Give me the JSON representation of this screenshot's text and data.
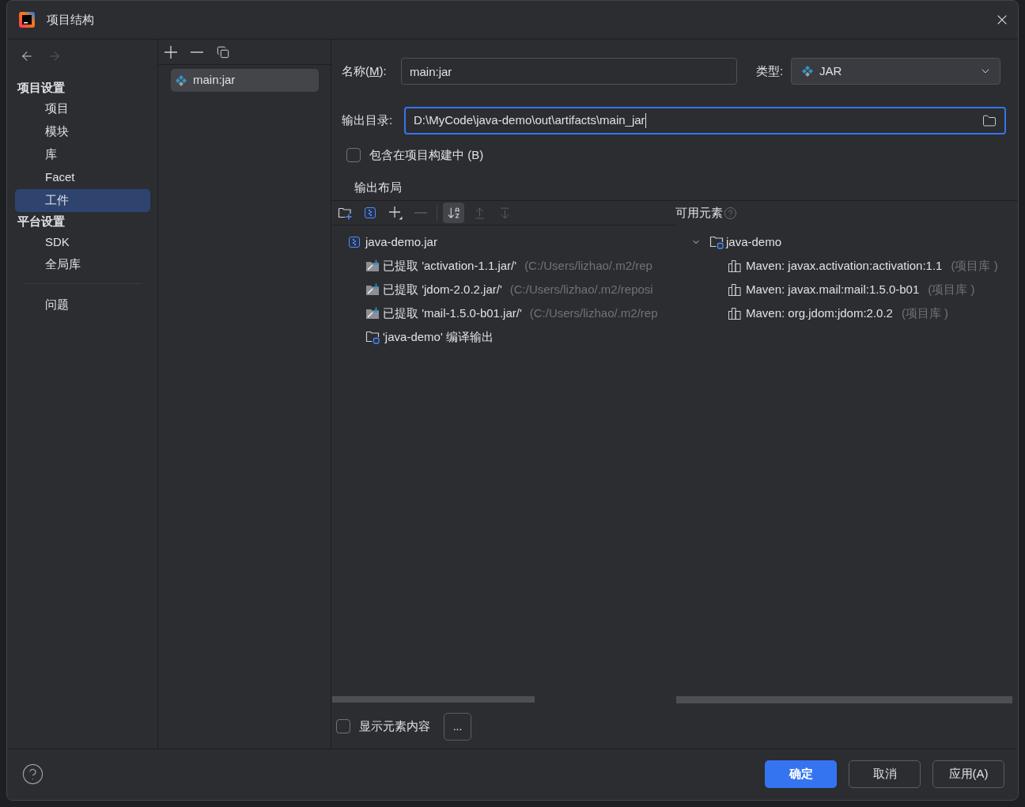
{
  "window": {
    "title": "项目结构"
  },
  "nav": [
    {
      "kind": "back",
      "disabled": false
    },
    {
      "kind": "forward",
      "disabled": true
    }
  ],
  "sidebar": {
    "sections": [
      {
        "heading": "项目设置",
        "items": [
          {
            "label": "项目",
            "selected": false
          },
          {
            "label": "模块",
            "selected": false
          },
          {
            "label": "库",
            "selected": false
          },
          {
            "label": "Facet",
            "selected": false
          },
          {
            "label": "工件",
            "selected": true
          }
        ]
      },
      {
        "heading": "平台设置",
        "items": [
          {
            "label": "SDK",
            "selected": false
          },
          {
            "label": "全局库",
            "selected": false
          }
        ]
      }
    ],
    "extra_items": [
      {
        "label": "问题",
        "selected": false
      }
    ]
  },
  "artifact_list": {
    "toolbar": [
      {
        "kind": "add",
        "disabled": false
      },
      {
        "kind": "remove",
        "disabled": false
      },
      {
        "kind": "copy",
        "disabled": false
      }
    ],
    "items": [
      {
        "label": "main:jar",
        "selected": true
      }
    ]
  },
  "form": {
    "name": {
      "label_before": "名称(",
      "mnemonic": "M",
      "label_after": "):",
      "value": "main:jar"
    },
    "type": {
      "label": "类型:",
      "value": "JAR"
    },
    "output_dir": {
      "label": "输出目录:",
      "value": "D:\\MyCode\\java-demo\\out\\artifacts\\main_jar",
      "focused": true
    },
    "include_in_build": {
      "label": "包含在项目构建中 (B)",
      "checked": false
    }
  },
  "layout_section": {
    "title": "输出布局",
    "toolbar": [
      [
        {
          "kind": "new-folder",
          "disabled": false,
          "on": false
        },
        {
          "kind": "archive",
          "disabled": false,
          "on": false
        },
        {
          "kind": "add-menu",
          "disabled": false,
          "on": false
        },
        {
          "kind": "remove",
          "disabled": true,
          "on": false
        }
      ],
      [
        {
          "kind": "sort",
          "disabled": false,
          "on": true
        },
        {
          "kind": "move-up",
          "disabled": true,
          "on": false
        },
        {
          "kind": "move-down",
          "disabled": true,
          "on": false
        }
      ]
    ],
    "output_tree": [
      {
        "kind": "archive",
        "label": "java-demo.jar",
        "children": [
          {
            "kind": "extracted",
            "label": "已提取 'activation-1.1.jar/'",
            "detail": "(C:/Users/lizhao/.m2/rep"
          },
          {
            "kind": "extracted",
            "label": "已提取 'jdom-2.0.2.jar/'",
            "detail": "(C:/Users/lizhao/.m2/reposi"
          },
          {
            "kind": "extracted",
            "label": "已提取 'mail-1.5.0-b01.jar/'",
            "detail": "(C:/Users/lizhao/.m2/rep"
          },
          {
            "kind": "module-output",
            "label": "'java-demo' 编译输出"
          }
        ]
      }
    ],
    "available": {
      "title": "可用元素",
      "tree": [
        {
          "kind": "module",
          "label": "java-demo",
          "expanded": true,
          "children": [
            {
              "kind": "library",
              "label": "Maven: javax.activation:activation:1.1",
              "detail": "(项目库 )"
            },
            {
              "kind": "library",
              "label": "Maven: javax.mail:mail:1.5.0-b01",
              "detail": "(项目库 )"
            },
            {
              "kind": "library",
              "label": "Maven: org.jdom:jdom:2.0.2",
              "detail": "(项目库 )"
            }
          ]
        }
      ]
    },
    "show_content": {
      "label": "显示元素内容",
      "checked": false
    },
    "more_button": "..."
  },
  "buttons": [
    {
      "label": "确定",
      "primary": true
    },
    {
      "label": "取消",
      "primary": false
    },
    {
      "label": "应用(A)",
      "primary": false
    }
  ]
}
